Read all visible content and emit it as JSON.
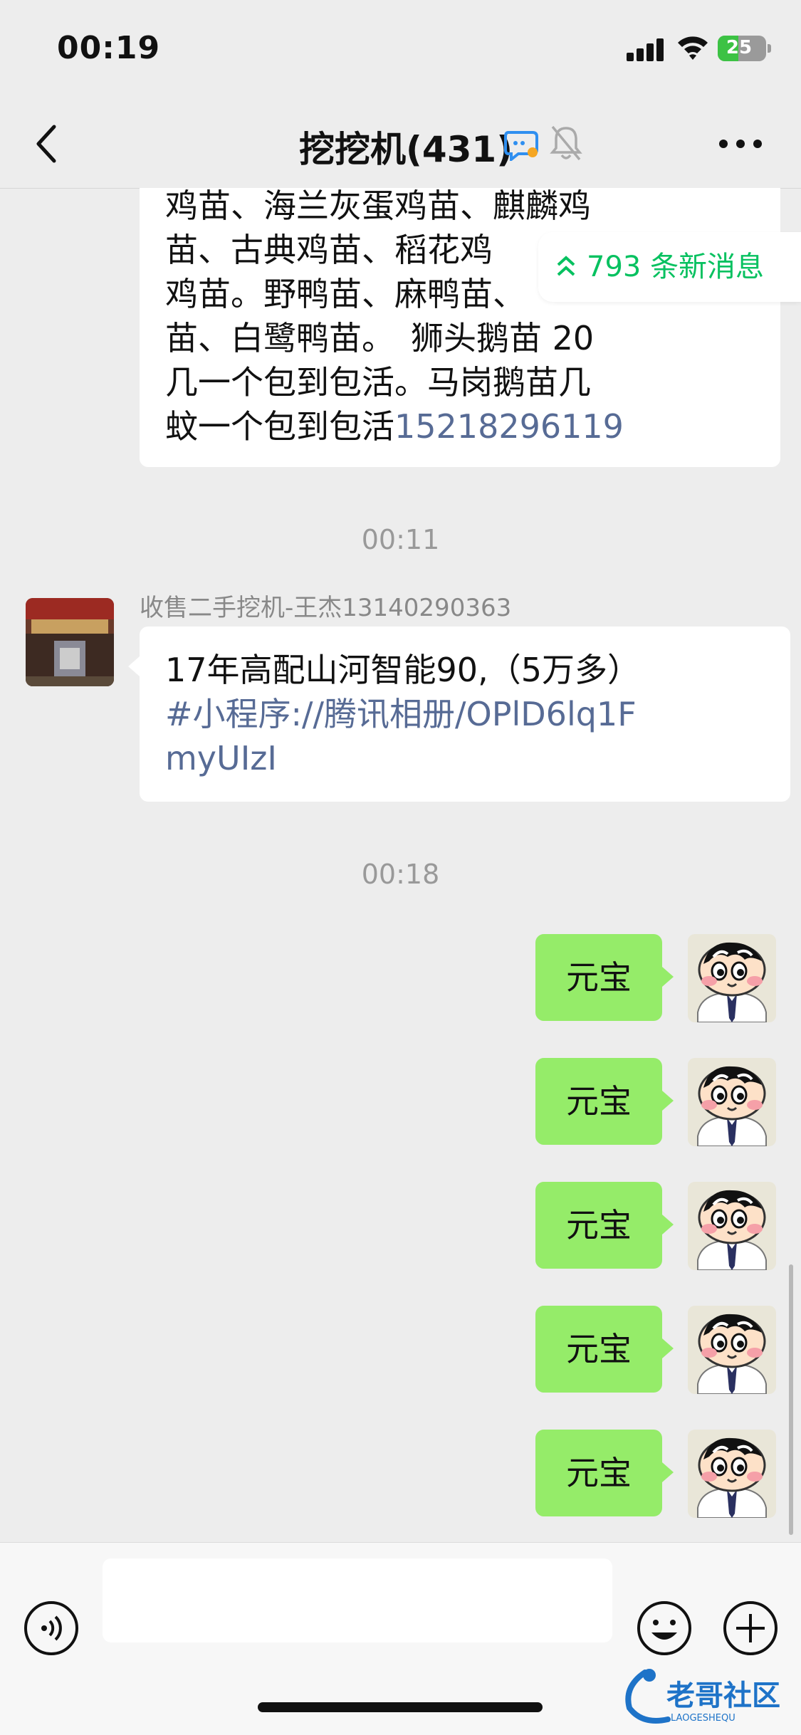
{
  "status_bar": {
    "time": "00:19",
    "battery": "25"
  },
  "nav": {
    "title": "挖挖机(431)",
    "icons": [
      "back-icon",
      "group-bubble-icon",
      "mute-bell-icon",
      "more-icon"
    ]
  },
  "top_message": {
    "lines": [
      "鸡苗、海兰灰蛋鸡苗、麒麟鸡",
      "苗、古典鸡苗、稻花鸡",
      "鸡苗。野鸭苗、麻鸭苗、",
      "苗、白鹭鸭苗。　狮头鹅苗 20",
      "几一个包到包活。马岗鹅苗几"
    ],
    "last_line_text": "蚊一个包到包活",
    "phone_link": "15218296119"
  },
  "new_messages": {
    "label": "793 条新消息"
  },
  "timestamps": [
    "00:11",
    "00:18"
  ],
  "received": {
    "sender": "收售二手挖机-王杰13140290363",
    "line1": "17年高配山河智能90,（5万多）",
    "link_line1": "#小程序://腾讯相册/OPlD6lq1F",
    "link_line2": "myUIzI"
  },
  "sent": [
    {
      "text": "元宝"
    },
    {
      "text": "元宝"
    },
    {
      "text": "元宝"
    },
    {
      "text": "元宝"
    },
    {
      "text": "元宝"
    }
  ],
  "input": {
    "placeholder": ""
  },
  "watermark": {
    "text": "老哥社区",
    "sub": "LAOGESHEQU"
  },
  "colors": {
    "my_bubble": "#95ec69",
    "link": "#576b95",
    "accent": "#07c160",
    "background": "#ededed"
  }
}
